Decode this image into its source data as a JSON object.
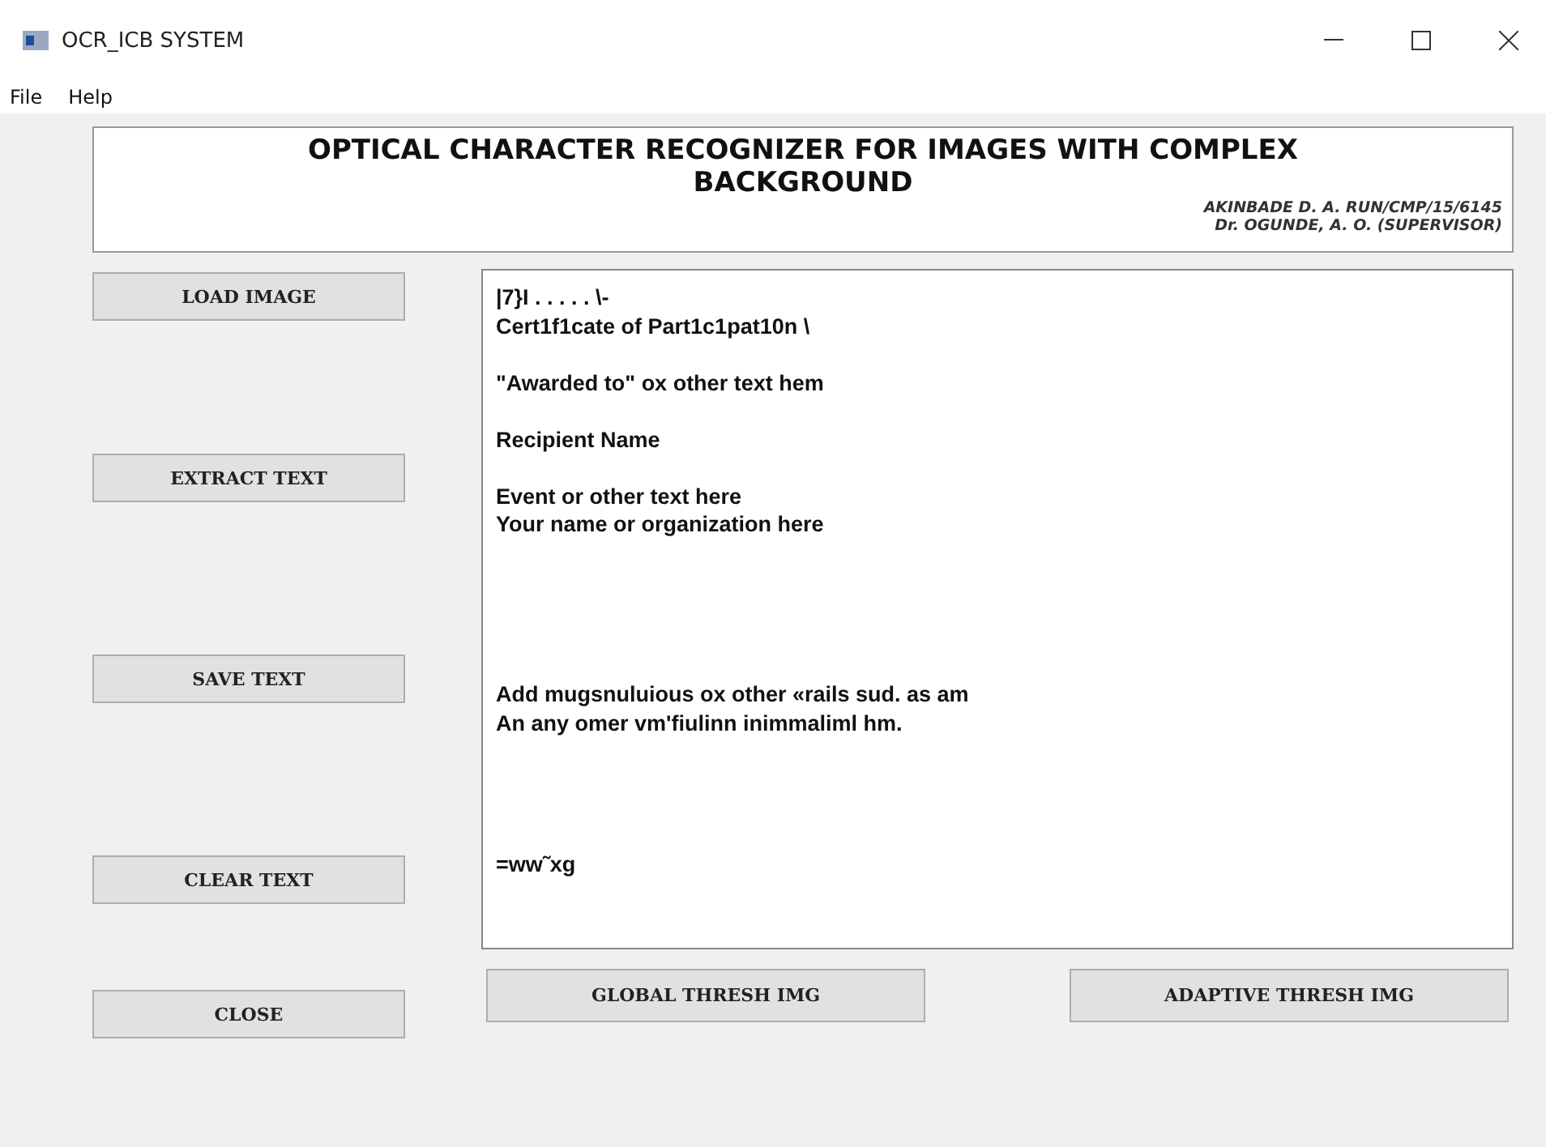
{
  "window": {
    "title": "OCR_ICB SYSTEM"
  },
  "menu": [
    "File",
    "Help"
  ],
  "header": {
    "title": "OPTICAL CHARACTER RECOGNIZER FOR IMAGES WITH COMPLEX BACKGROUND",
    "credits": [
      "AKINBADE D. A. RUN/CMP/15/6145",
      "Dr. OGUNDE, A. O. (SUPERVISOR)"
    ]
  },
  "side_buttons": [
    "LOAD IMAGE",
    "EXTRACT TEXT",
    "SAVE TEXT",
    "CLEAR TEXT",
    "CLOSE"
  ],
  "output_text": "|7}I . . . . . \\-\nCert1f1cate of Part1c1pat10n \\\n\n\"Awarded to\" ox other text hem\n\nRecipient Name\n\nEvent or other text here\nYour name or organization here\n\n\n\n\n\nAdd mugsnuluious ox other «rails sud. as am\nAn any omer vm'fiulinn inimmaliml hm.\n\n\n\n\n=ww˜xg",
  "bottom_buttons": [
    "GLOBAL THRESH IMG",
    "ADAPTIVE THRESH IMG"
  ]
}
